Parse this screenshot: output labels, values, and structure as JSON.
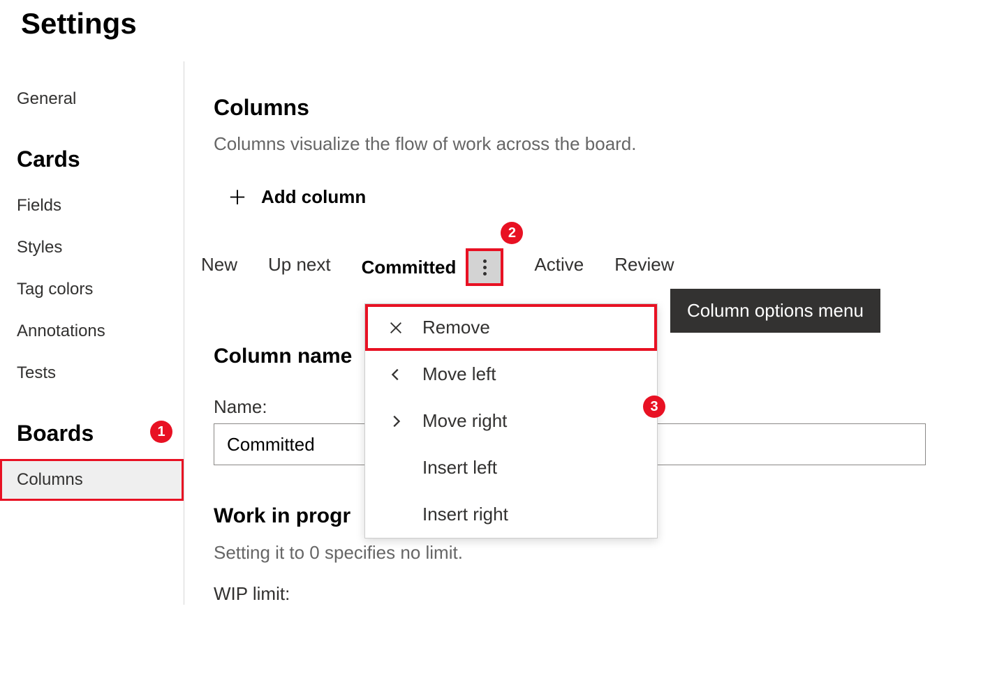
{
  "page_title": "Settings",
  "sidebar": {
    "item_general": "General",
    "section_cards": "Cards",
    "item_fields": "Fields",
    "item_styles": "Styles",
    "item_tag_colors": "Tag colors",
    "item_annotations": "Annotations",
    "item_tests": "Tests",
    "section_boards": "Boards",
    "item_columns": "Columns"
  },
  "main": {
    "heading": "Columns",
    "description": "Columns visualize the flow of work across the board.",
    "add_column_label": "Add column",
    "tabs": {
      "new": "New",
      "up_next": "Up next",
      "committed": "Committed",
      "active": "Active",
      "review": "Review"
    },
    "tooltip": "Column options menu",
    "menu": {
      "remove": "Remove",
      "move_left": "Move left",
      "move_right": "Move right",
      "insert_left": "Insert left",
      "insert_right": "Insert right"
    },
    "form": {
      "column_name_heading": "Column name",
      "name_label": "Name:",
      "name_value": "Committed",
      "wip_heading": "Work in progr",
      "wip_description": "Setting it to 0 specifies no limit.",
      "wip_label": "WIP limit:"
    }
  },
  "callouts": {
    "one": "1",
    "two": "2",
    "three": "3"
  }
}
